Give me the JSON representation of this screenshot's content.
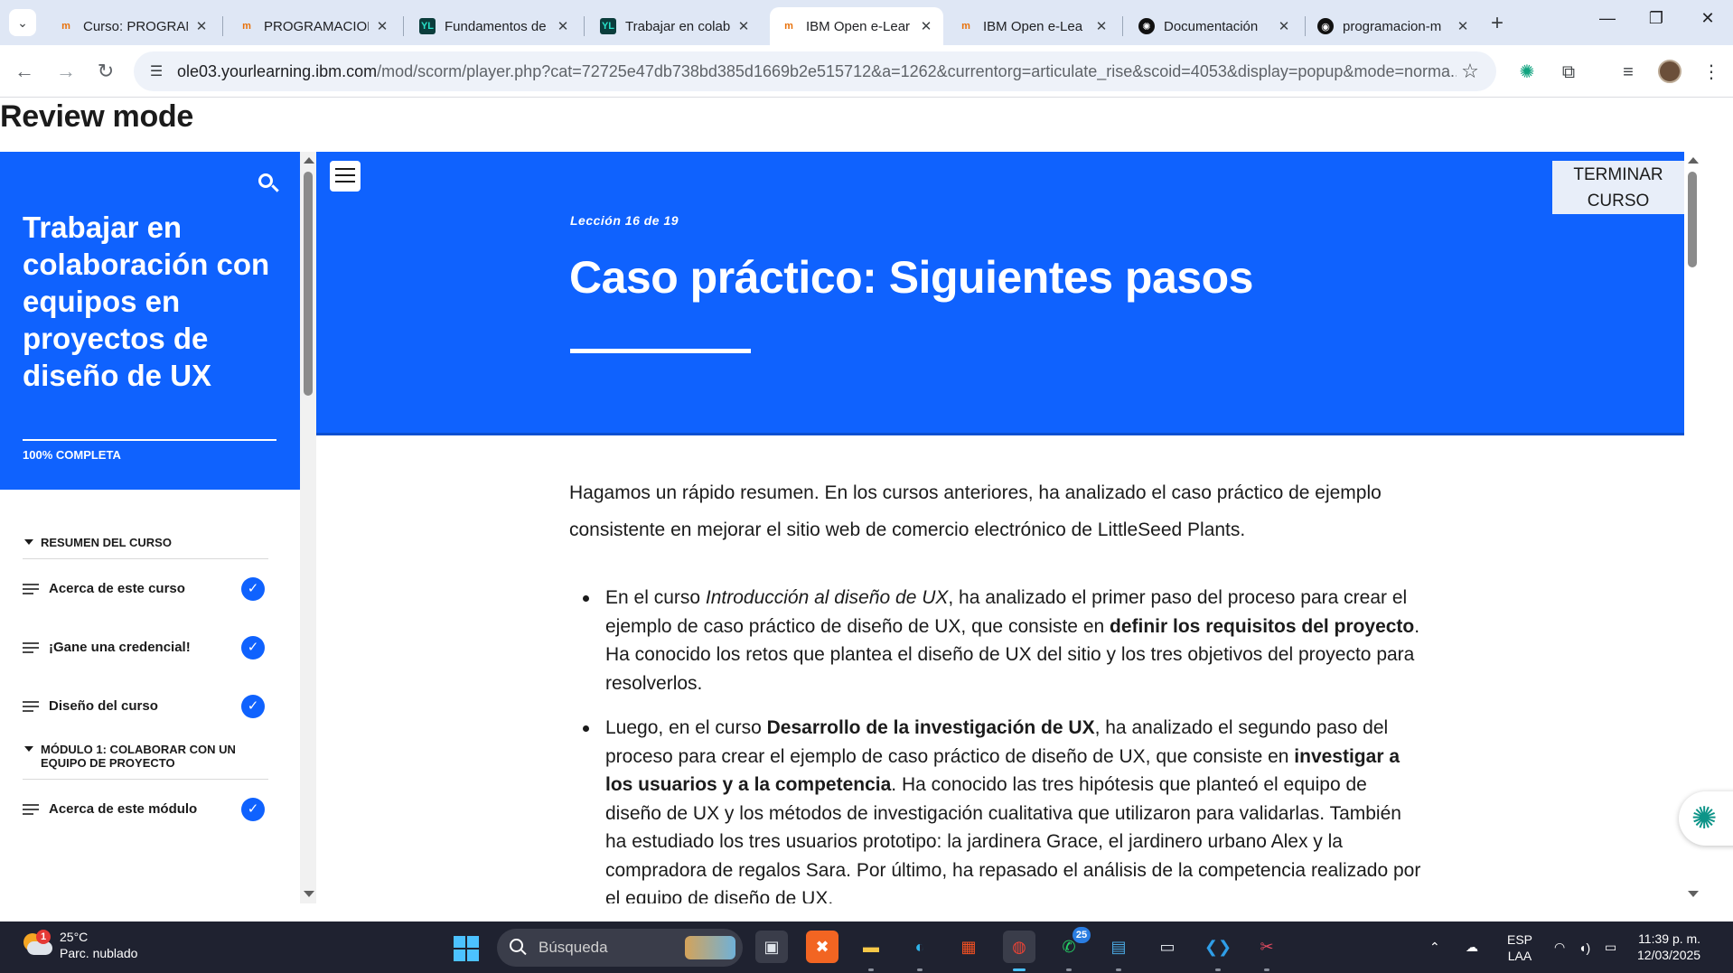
{
  "browser": {
    "tabs": [
      {
        "title": "Curso: PROGRAM",
        "icon": "ibm-icon",
        "active": false
      },
      {
        "title": "PROGRAMACION",
        "icon": "ibm-icon",
        "active": false
      },
      {
        "title": "Fundamentos de",
        "icon": "yl-icon",
        "active": false
      },
      {
        "title": "Trabajar en colab",
        "icon": "yl-icon",
        "active": false
      },
      {
        "title": "IBM Open e-Lear",
        "icon": "ibm-icon",
        "active": true
      },
      {
        "title": "IBM Open e-Lea",
        "icon": "ibm-icon",
        "active": false
      },
      {
        "title": "Documentación",
        "icon": "openai-icon",
        "active": false
      },
      {
        "title": "programacion-m",
        "icon": "github-icon",
        "active": false
      }
    ],
    "url_host": "ole03.yourlearning.ibm.com",
    "url_path": "/mod/scorm/player.php?cat=72725e47db738bd385d1669b2e515712&a=1262&currentorg=articulate_rise&scoid=4053&display=popup&mode=norma..."
  },
  "page": {
    "review_label": "Review mode"
  },
  "sidebar": {
    "course_title": "Trabajar en colaboración con equipos en proyectos de diseño de UX",
    "progress": "100% COMPLETA",
    "sections": [
      {
        "title": "RESUMEN DEL CURSO",
        "lessons": [
          {
            "label": "Acerca de este curso",
            "complete": true
          },
          {
            "label": "¡Gane una credencial!",
            "complete": true
          },
          {
            "label": "Diseño del curso",
            "complete": true
          }
        ]
      },
      {
        "title": "MÓDULO 1: COLABORAR CON UN EQUIPO DE PROYECTO",
        "lessons": [
          {
            "label": "Acerca de este módulo",
            "complete": true
          }
        ]
      }
    ]
  },
  "lesson": {
    "counter": "Lección 16 de 19",
    "title": "Caso práctico: Siguientes pasos",
    "finish_label": "TERMINAR CURSO",
    "intro": "Hagamos un rápido resumen. En los cursos anteriores, ha analizado el caso práctico de ejemplo consistente en mejorar el sitio web de comercio electrónico de LittleSeed Plants.",
    "bullet1": {
      "a": "En el curso ",
      "b": "Introducción al diseño de UX",
      "c": ", ha analizado el primer paso del proceso para crear el ejemplo de caso práctico de diseño de UX, que consiste en ",
      "d": "definir los requisitos del proyecto",
      "e": ". Ha conocido los retos que plantea el diseño de UX del sitio y los tres objetivos del proyecto para resolverlos."
    },
    "bullet2": {
      "a": "Luego, en el curso ",
      "b": "Desarrollo de la investigación de UX",
      "c": ", ha analizado el segundo paso del proceso para crear el ejemplo de caso práctico de diseño de UX, que consiste en ",
      "d": "investigar a los usuarios y a la competencia",
      "e": ". Ha conocido las tres hipótesis que planteó el equipo de diseño de UX y los métodos de investigación cualitativa que utilizaron para validarlas. También ha estudiado los tres usuarios prototipo: la jardinera Grace, el jardinero urbano Alex y la compradora de regalos Sara. Por último, ha repasado el análisis de la competencia realizado por el equipo de diseño de UX."
    }
  },
  "taskbar": {
    "weather_temp": "25°C",
    "weather_desc": "Parc. nublado",
    "weather_badge": "1",
    "search_placeholder": "Búsqueda",
    "whatsapp_badge": "25",
    "lang1": "ESP",
    "lang2": "LAA",
    "time": "11:39 p. m.",
    "date": "12/03/2025"
  },
  "colors": {
    "brand_blue": "#0f62fe",
    "taskbar": "#1f2230"
  }
}
